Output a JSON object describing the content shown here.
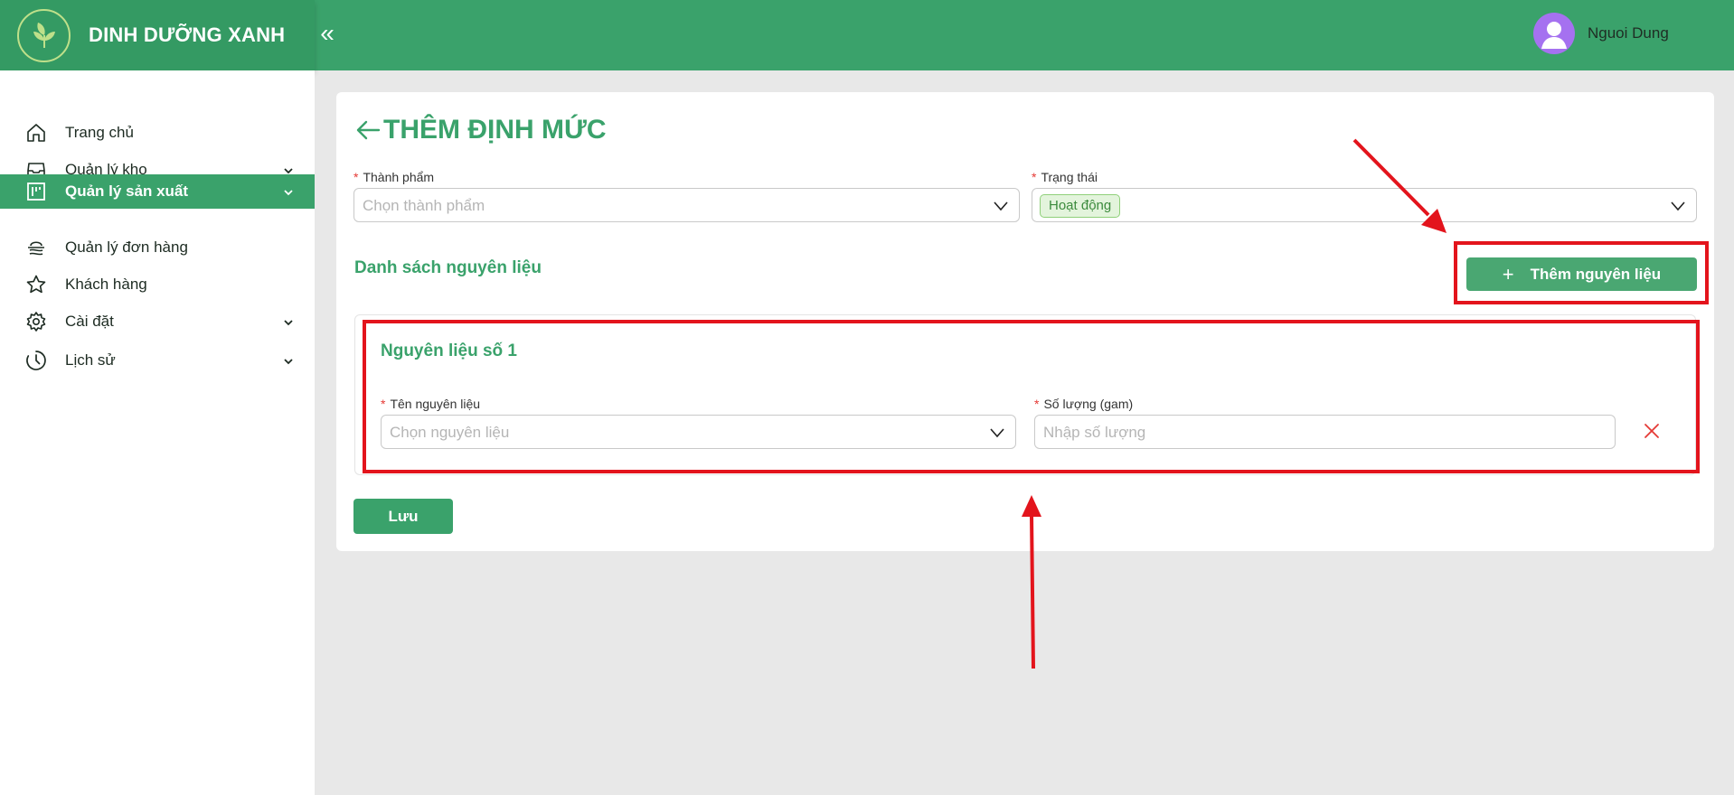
{
  "header": {
    "brand_name": "DINH DƯỠNG XANH",
    "collapse_symbol": "«",
    "user_name": "Nguoi Dung"
  },
  "sidebar": {
    "items": [
      {
        "label": "Trang chủ",
        "icon": "home-icon",
        "has_chevron": false,
        "active": false
      },
      {
        "label": "Quản lý kho",
        "icon": "inbox-icon",
        "has_chevron": true,
        "active": false
      },
      {
        "label": "Quản lý sản xuất",
        "icon": "production-icon",
        "has_chevron": true,
        "active": true
      },
      {
        "label": "Quản lý đơn hàng",
        "icon": "order-icon",
        "has_chevron": false,
        "active": false
      },
      {
        "label": "Khách hàng",
        "icon": "star-icon",
        "has_chevron": false,
        "active": false
      },
      {
        "label": "Cài đặt",
        "icon": "gear-icon",
        "has_chevron": true,
        "active": false
      },
      {
        "label": "Lịch sử",
        "icon": "history-icon",
        "has_chevron": true,
        "active": false
      }
    ]
  },
  "page": {
    "title": "THÊM ĐỊNH MỨC",
    "required_mark": "*",
    "product": {
      "label": "Thành phẩm",
      "placeholder": "Chọn thành phẩm"
    },
    "status": {
      "label": "Trạng thái",
      "value": "Hoạt động"
    },
    "ingredients_section": {
      "title": "Danh sách nguyên liệu",
      "add_button_label": "Thêm nguyên liệu",
      "add_button_symbol": "+"
    },
    "ingredient": {
      "title": "Nguyên liệu số 1",
      "name_label": "Tên nguyên liệu",
      "name_placeholder": "Chọn nguyên liệu",
      "qty_label": "Số lượng (gam)",
      "qty_placeholder": "Nhập số lượng"
    },
    "save_label": "Lưu"
  },
  "colors": {
    "brand_green": "#3aa26b",
    "annotation_red": "#e3141c",
    "avatar_purple": "#a571f0"
  }
}
